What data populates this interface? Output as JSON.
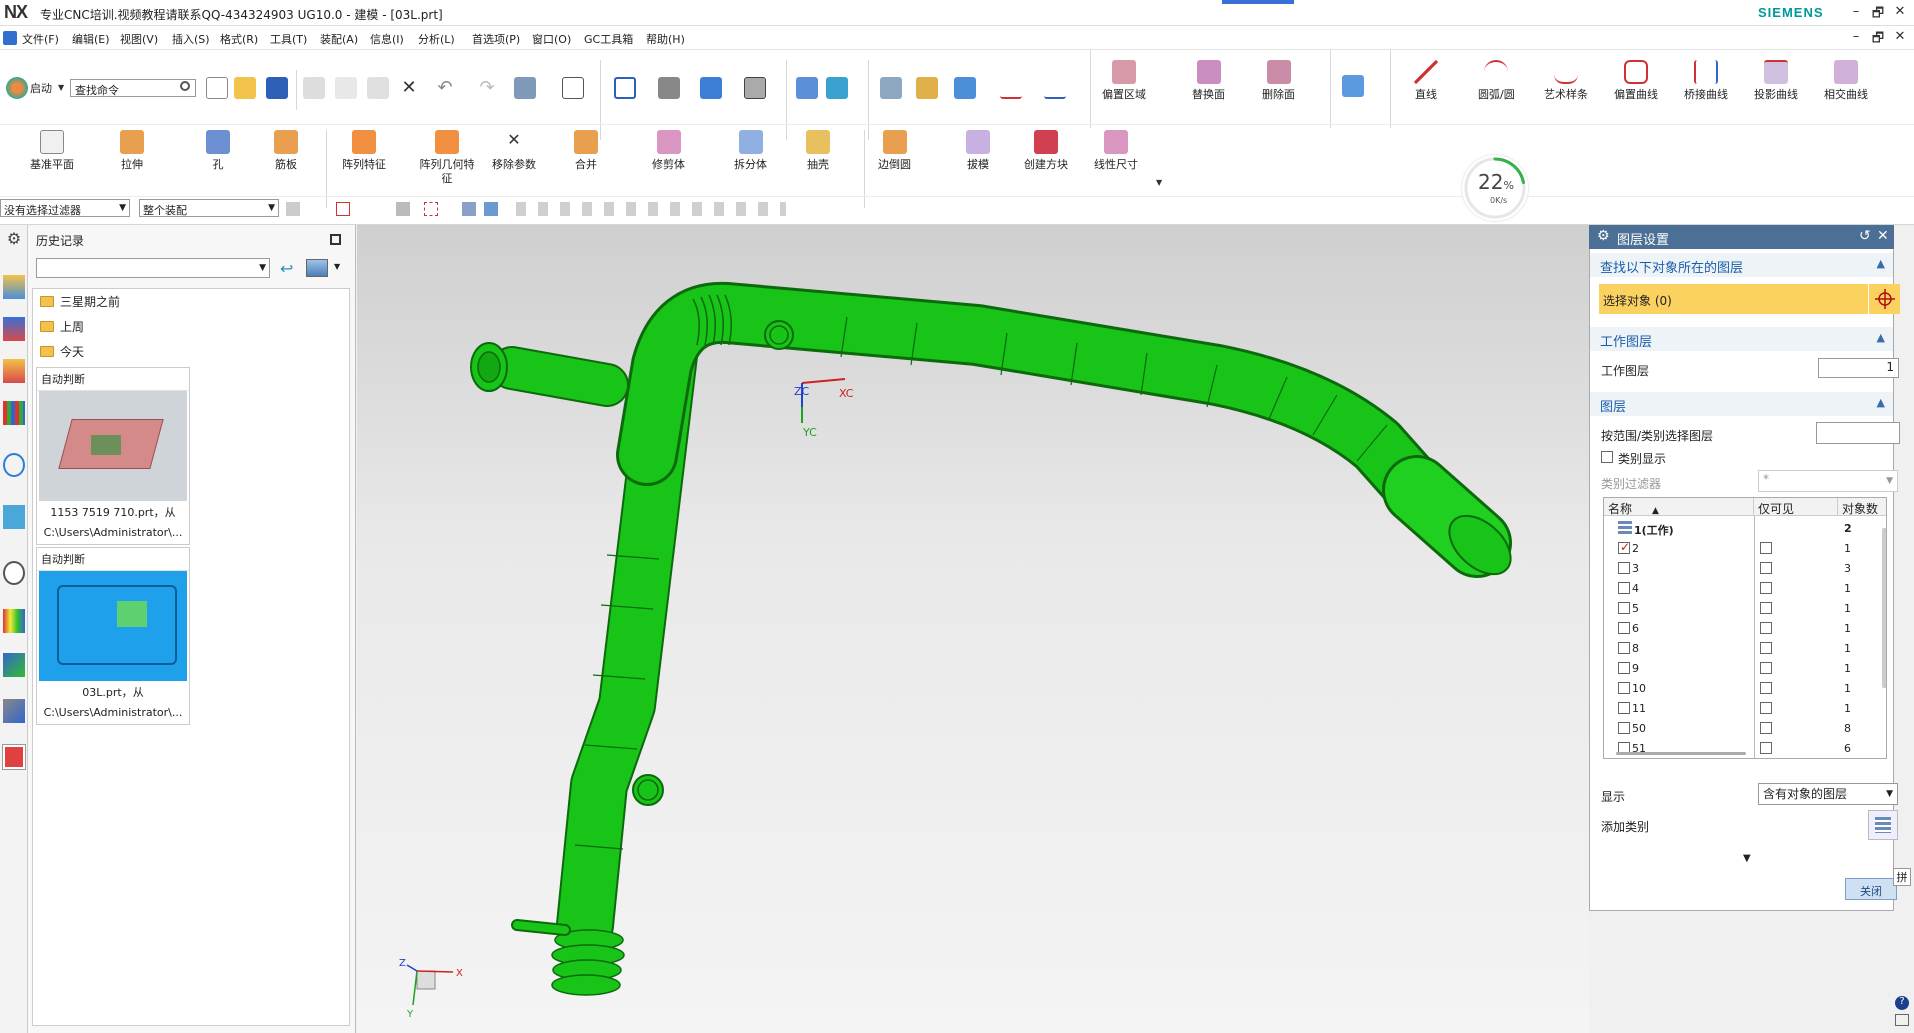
{
  "titlebar": {
    "logo": "NX",
    "title": "专业CNC培训.视频教程请联系QQ-434324903 UG10.0 - 建模 - [03L.prt]",
    "brand": "SIEMENS",
    "win_min": "–",
    "win_restore": "🗗",
    "win_close": "✕"
  },
  "menubar": {
    "items": [
      "文件(F)",
      "编辑(E)",
      "视图(V)",
      "插入(S)",
      "格式(R)",
      "工具(T)",
      "装配(A)",
      "信息(I)",
      "分析(L)",
      "首选项(P)",
      "窗口(O)",
      "GC工具箱",
      "帮助(H)"
    ],
    "mdi_min": "–",
    "mdi_restore": "🗗",
    "mdi_close": "✕"
  },
  "ribbon": {
    "start_label": "启动",
    "search_value": "查找命令",
    "row1_buttons": [
      "偏置区域",
      "替换面",
      "删除面",
      "直线",
      "圆弧/圆",
      "艺术样条",
      "偏置曲线",
      "桥接曲线",
      "投影曲线",
      "相交曲线"
    ],
    "row2_buttons": [
      "基准平面",
      "拉伸",
      "孔",
      "筋板",
      "阵列特征",
      "阵列几何特征",
      "移除参数",
      "合并",
      "修剪体",
      "拆分体",
      "抽壳",
      "边倒圆",
      "拔模",
      "创建方块",
      "线性尺寸"
    ],
    "filter_value": "没有选择过滤器",
    "assembly_value": "整个装配"
  },
  "progress": {
    "percent": "22",
    "unit": "0K/s",
    "value": 0.22
  },
  "history": {
    "title": "历史记录",
    "folders": [
      "三星期之前",
      "上周",
      "今天"
    ],
    "cards": [
      {
        "header": "自动判断",
        "caption1": "1153 7519 710.prt，从",
        "caption2": "C:\\Users\\Administrator\\..."
      },
      {
        "header": "自动判断",
        "caption1": "03L.prt，从",
        "caption2": "C:\\Users\\Administrator\\..."
      }
    ]
  },
  "viewport": {
    "axis_xc": "XC",
    "axis_yc": "YC",
    "axis_zc": "ZC",
    "triad_x": "X",
    "triad_y": "Y",
    "triad_z": "Z",
    "model_color": "#18c418"
  },
  "layer_panel": {
    "title": "图层设置",
    "sect_find": "查找以下对象所在的图层",
    "select_object": "选择对象 (0)",
    "sect_work": "工作图层",
    "work_layer_label": "工作图层",
    "work_layer_value": "1",
    "sect_layers": "图层",
    "by_range_label": "按范围/类别选择图层",
    "category_display": "类别显示",
    "category_filter_label": "类别过滤器",
    "category_filter_value": "*",
    "col_name": "名称",
    "col_visible_only": "仅可见",
    "col_count": "对象数",
    "rows": [
      {
        "name": "1(工作)",
        "count": "2",
        "checked": true,
        "work": true
      },
      {
        "name": "2",
        "count": "1",
        "checked": true
      },
      {
        "name": "3",
        "count": "3",
        "checked": false
      },
      {
        "name": "4",
        "count": "1",
        "checked": false
      },
      {
        "name": "5",
        "count": "1",
        "checked": false
      },
      {
        "name": "6",
        "count": "1",
        "checked": false
      },
      {
        "name": "8",
        "count": "1",
        "checked": false
      },
      {
        "name": "9",
        "count": "1",
        "checked": false
      },
      {
        "name": "10",
        "count": "1",
        "checked": false
      },
      {
        "name": "11",
        "count": "1",
        "checked": false
      },
      {
        "name": "50",
        "count": "8",
        "checked": false
      },
      {
        "name": "51",
        "count": "6",
        "checked": false
      }
    ],
    "display_label": "显示",
    "display_value": "含有对象的图层",
    "add_category_label": "添加类别",
    "close_label": "关闭",
    "side_label": "拼"
  }
}
